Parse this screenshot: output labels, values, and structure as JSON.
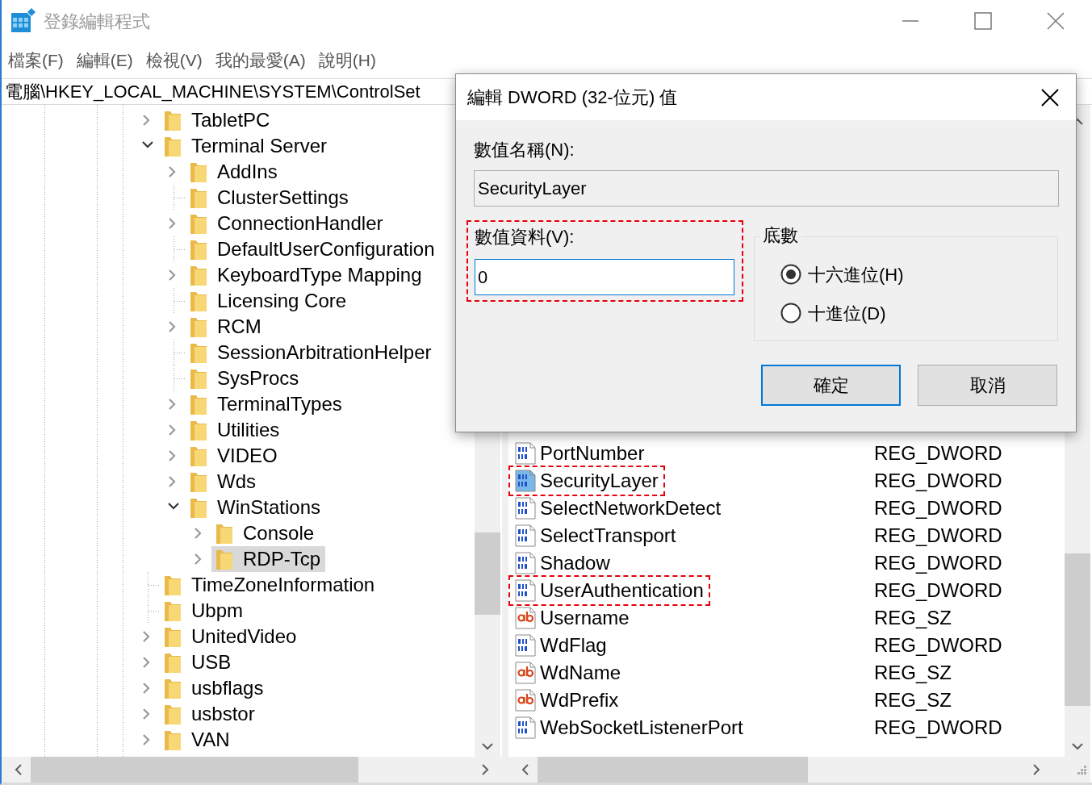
{
  "window": {
    "title": "登錄編輯程式"
  },
  "menu": [
    "檔案(F)",
    "編輯(E)",
    "檢視(V)",
    "我的最愛(A)",
    "說明(H)"
  ],
  "address": "電腦\\HKEY_LOCAL_MACHINE\\SYSTEM\\ControlSet",
  "tree": [
    {
      "label": "TabletPC",
      "kind": "branch",
      "expanded": false,
      "selected": false
    },
    {
      "label": "Terminal Server",
      "kind": "branch",
      "expanded": true,
      "selected": false,
      "children": [
        {
          "label": "AddIns",
          "kind": "branch",
          "expanded": false,
          "selected": false
        },
        {
          "label": "ClusterSettings",
          "kind": "leaf",
          "selected": false
        },
        {
          "label": "ConnectionHandler",
          "kind": "branch",
          "expanded": false,
          "selected": false
        },
        {
          "label": "DefaultUserConfiguration",
          "kind": "leaf",
          "selected": false
        },
        {
          "label": "KeyboardType Mapping",
          "kind": "branch",
          "expanded": false,
          "selected": false
        },
        {
          "label": "Licensing Core",
          "kind": "leaf",
          "selected": false
        },
        {
          "label": "RCM",
          "kind": "branch",
          "expanded": false,
          "selected": false
        },
        {
          "label": "SessionArbitrationHelper",
          "kind": "leaf",
          "selected": false
        },
        {
          "label": "SysProcs",
          "kind": "leaf",
          "selected": false
        },
        {
          "label": "TerminalTypes",
          "kind": "branch",
          "expanded": false,
          "selected": false
        },
        {
          "label": "Utilities",
          "kind": "branch",
          "expanded": false,
          "selected": false
        },
        {
          "label": "VIDEO",
          "kind": "branch",
          "expanded": false,
          "selected": false
        },
        {
          "label": "Wds",
          "kind": "branch",
          "expanded": false,
          "selected": false
        },
        {
          "label": "WinStations",
          "kind": "branch",
          "expanded": true,
          "selected": false,
          "children": [
            {
              "label": "Console",
              "kind": "branch",
              "expanded": false,
              "selected": false
            },
            {
              "label": "RDP-Tcp",
              "kind": "branch",
              "expanded": false,
              "selected": true
            }
          ]
        }
      ]
    },
    {
      "label": "TimeZoneInformation",
      "kind": "leaf",
      "selected": false
    },
    {
      "label": "Ubpm",
      "kind": "leaf",
      "selected": false
    },
    {
      "label": "UnitedVideo",
      "kind": "branch",
      "expanded": false,
      "selected": false
    },
    {
      "label": "USB",
      "kind": "branch",
      "expanded": false,
      "selected": false
    },
    {
      "label": "usbflags",
      "kind": "branch",
      "expanded": false,
      "selected": false
    },
    {
      "label": "usbstor",
      "kind": "branch",
      "expanded": false,
      "selected": false
    },
    {
      "label": "VAN",
      "kind": "branch",
      "expanded": false,
      "selected": false
    }
  ],
  "values": [
    {
      "name": "PortNumber",
      "type": "REG_DWORD",
      "kind": "dword",
      "selected": false,
      "highlighted": false
    },
    {
      "name": "SecurityLayer",
      "type": "REG_DWORD",
      "kind": "dword",
      "selected": true,
      "highlighted": true
    },
    {
      "name": "SelectNetworkDetect",
      "type": "REG_DWORD",
      "kind": "dword",
      "selected": false,
      "highlighted": false
    },
    {
      "name": "SelectTransport",
      "type": "REG_DWORD",
      "kind": "dword",
      "selected": false,
      "highlighted": false
    },
    {
      "name": "Shadow",
      "type": "REG_DWORD",
      "kind": "dword",
      "selected": false,
      "highlighted": false
    },
    {
      "name": "UserAuthentication",
      "type": "REG_DWORD",
      "kind": "dword",
      "selected": false,
      "highlighted": true
    },
    {
      "name": "Username",
      "type": "REG_SZ",
      "kind": "sz",
      "selected": false,
      "highlighted": false
    },
    {
      "name": "WdFlag",
      "type": "REG_DWORD",
      "kind": "dword",
      "selected": false,
      "highlighted": false
    },
    {
      "name": "WdName",
      "type": "REG_SZ",
      "kind": "sz",
      "selected": false,
      "highlighted": false
    },
    {
      "name": "WdPrefix",
      "type": "REG_SZ",
      "kind": "sz",
      "selected": false,
      "highlighted": false
    },
    {
      "name": "WebSocketListenerPort",
      "type": "REG_DWORD",
      "kind": "dword",
      "selected": false,
      "highlighted": false
    }
  ],
  "dialog": {
    "title": "編輯 DWORD (32-位元) 值",
    "name_label": "數值名稱(N):",
    "name_value": "SecurityLayer",
    "data_label": "數值資料(V):",
    "data_value": "0",
    "data_highlighted": true,
    "base_label": "底數",
    "bases": [
      {
        "label": "十六進位(H)",
        "selected": true
      },
      {
        "label": "十進位(D)",
        "selected": false
      }
    ],
    "buttons": [
      {
        "label": "確定",
        "default": true
      },
      {
        "label": "取消",
        "default": false
      }
    ]
  }
}
